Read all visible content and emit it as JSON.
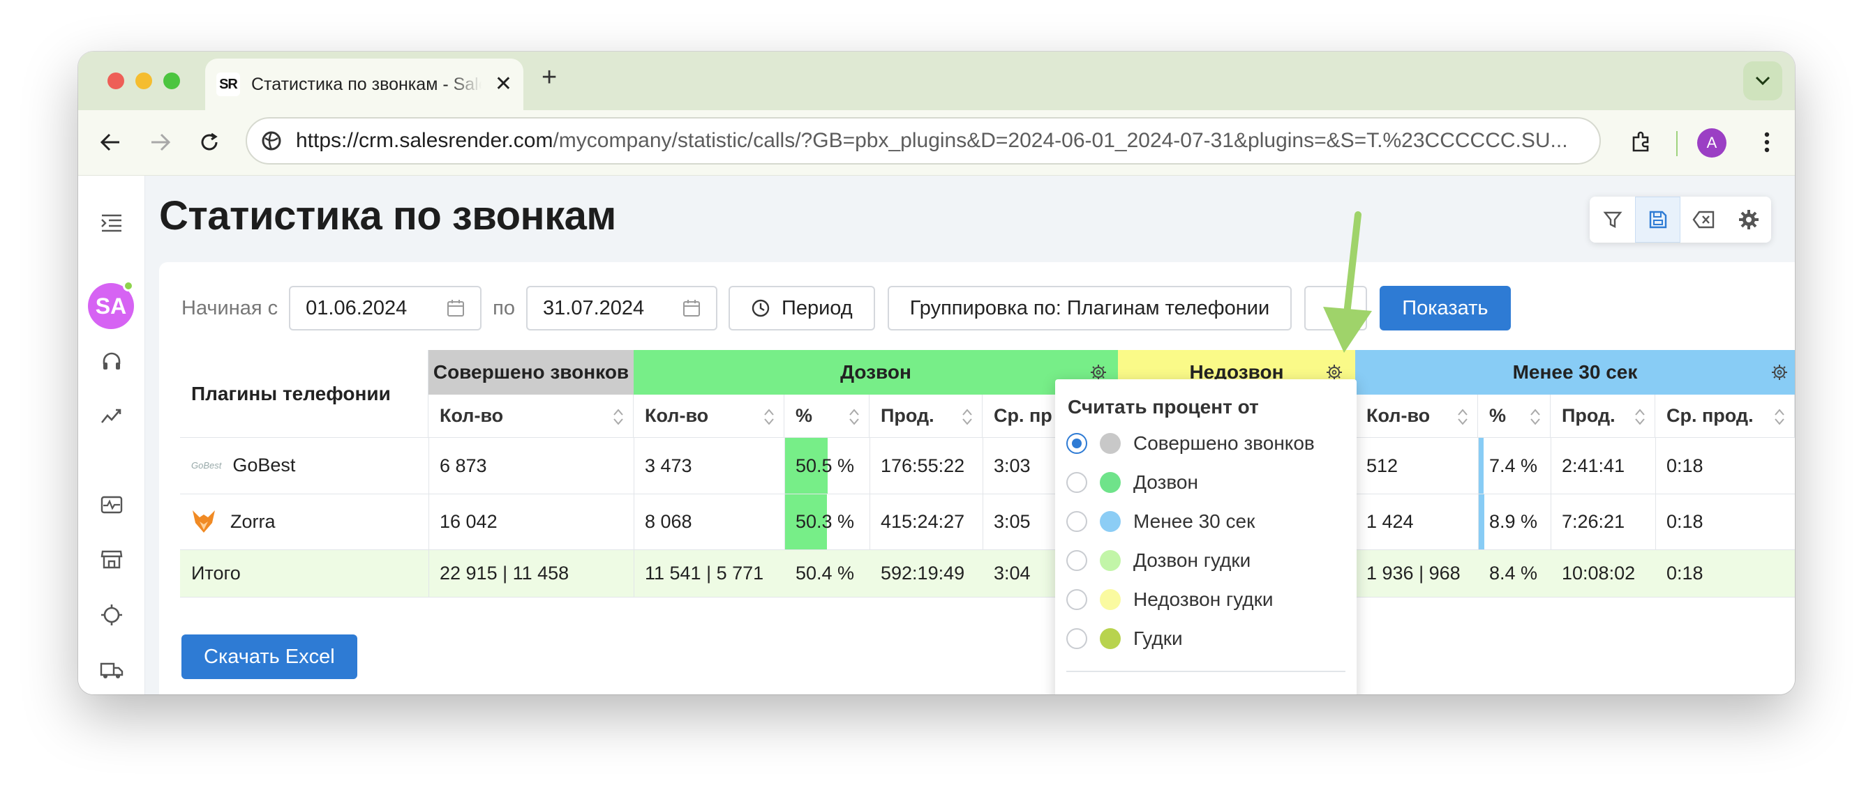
{
  "browser": {
    "tab_title": "Статистика по звонкам - SalesRender",
    "favicon_text": "SR",
    "url_main": "https://crm.salesrender.com",
    "url_rest": "/mycompany/statistic/calls/?GB=pbx_plugins&D=2024-06-01_2024-07-31&plugins=&S=T.%23CCCCCC.SU...",
    "profile_initial": "A"
  },
  "sidebar": {
    "avatar_initials": "SA"
  },
  "page": {
    "title": "Статистика по звонкам"
  },
  "filters": {
    "from_label": "Начиная с",
    "from_value": "01.06.2024",
    "to_label": "по",
    "to_value": "31.07.2024",
    "period_label": "Период",
    "grouping_label": "Группировка по: Плагинам телефонии",
    "show_label": "Показать"
  },
  "table": {
    "row_header": "Плагины телефонии",
    "groups": {
      "made": "Совершено звонков",
      "connected": "Дозвон",
      "failed": "Недозвон",
      "under30": "Менее 30 сек"
    },
    "subheaders": {
      "count": "Кол-во",
      "percent": "%",
      "duration": "Прод.",
      "avg": "Ср. пр",
      "avg_full": "Ср. прод."
    },
    "rows": [
      {
        "name": "GoBest",
        "made": "6 873",
        "conn_count": "3 473",
        "conn_pct": "50.5 %",
        "conn_pct_value": 50.5,
        "conn_dur": "176:55:22",
        "conn_avg": "3:03",
        "u30_count": "512",
        "u30_pct": "7.4 %",
        "u30_pct_value": 7.4,
        "u30_dur": "2:41:41",
        "u30_avg": "0:18"
      },
      {
        "name": "Zorra",
        "made": "16 042",
        "conn_count": "8 068",
        "conn_pct": "50.3 %",
        "conn_pct_value": 50.3,
        "conn_dur": "415:24:27",
        "conn_avg": "3:05",
        "u30_count": "1 424",
        "u30_pct": "8.9 %",
        "u30_pct_value": 8.9,
        "u30_dur": "7:26:21",
        "u30_avg": "0:18"
      }
    ],
    "total": {
      "name": "Итого",
      "made": "22 915 | 11 458",
      "conn_count": "11 541 | 5 771",
      "conn_pct": "50.4 %",
      "conn_dur": "592:19:49",
      "conn_avg": "3:04",
      "u30_count": "1 936 | 968",
      "u30_pct": "8.4 %",
      "u30_dur": "10:08:02",
      "u30_avg": "0:18"
    }
  },
  "download_label": "Скачать Excel",
  "popup": {
    "title": "Считать процент от",
    "options": [
      {
        "label": "Совершено звонков",
        "color": "#c8c8c8",
        "selected": true
      },
      {
        "label": "Дозвон",
        "color": "#6fe38a",
        "selected": false
      },
      {
        "label": "Менее 30 сек",
        "color": "#8ccdf5",
        "selected": false
      },
      {
        "label": "Дозвон гудки",
        "color": "#c2f5a8",
        "selected": false
      },
      {
        "label": "Недозвон гудки",
        "color": "#fafaa0",
        "selected": false
      },
      {
        "label": "Гудки",
        "color": "#b8d34e",
        "selected": false
      }
    ]
  },
  "colors": {
    "made_header": "#cccccc",
    "connected_header": "#77ee88",
    "failed_header": "#fafa88",
    "under30_header": "#88ccf5",
    "total_row": "#eefbe4",
    "primary_button": "#2e7bd4",
    "arrow": "#9fd36a"
  }
}
